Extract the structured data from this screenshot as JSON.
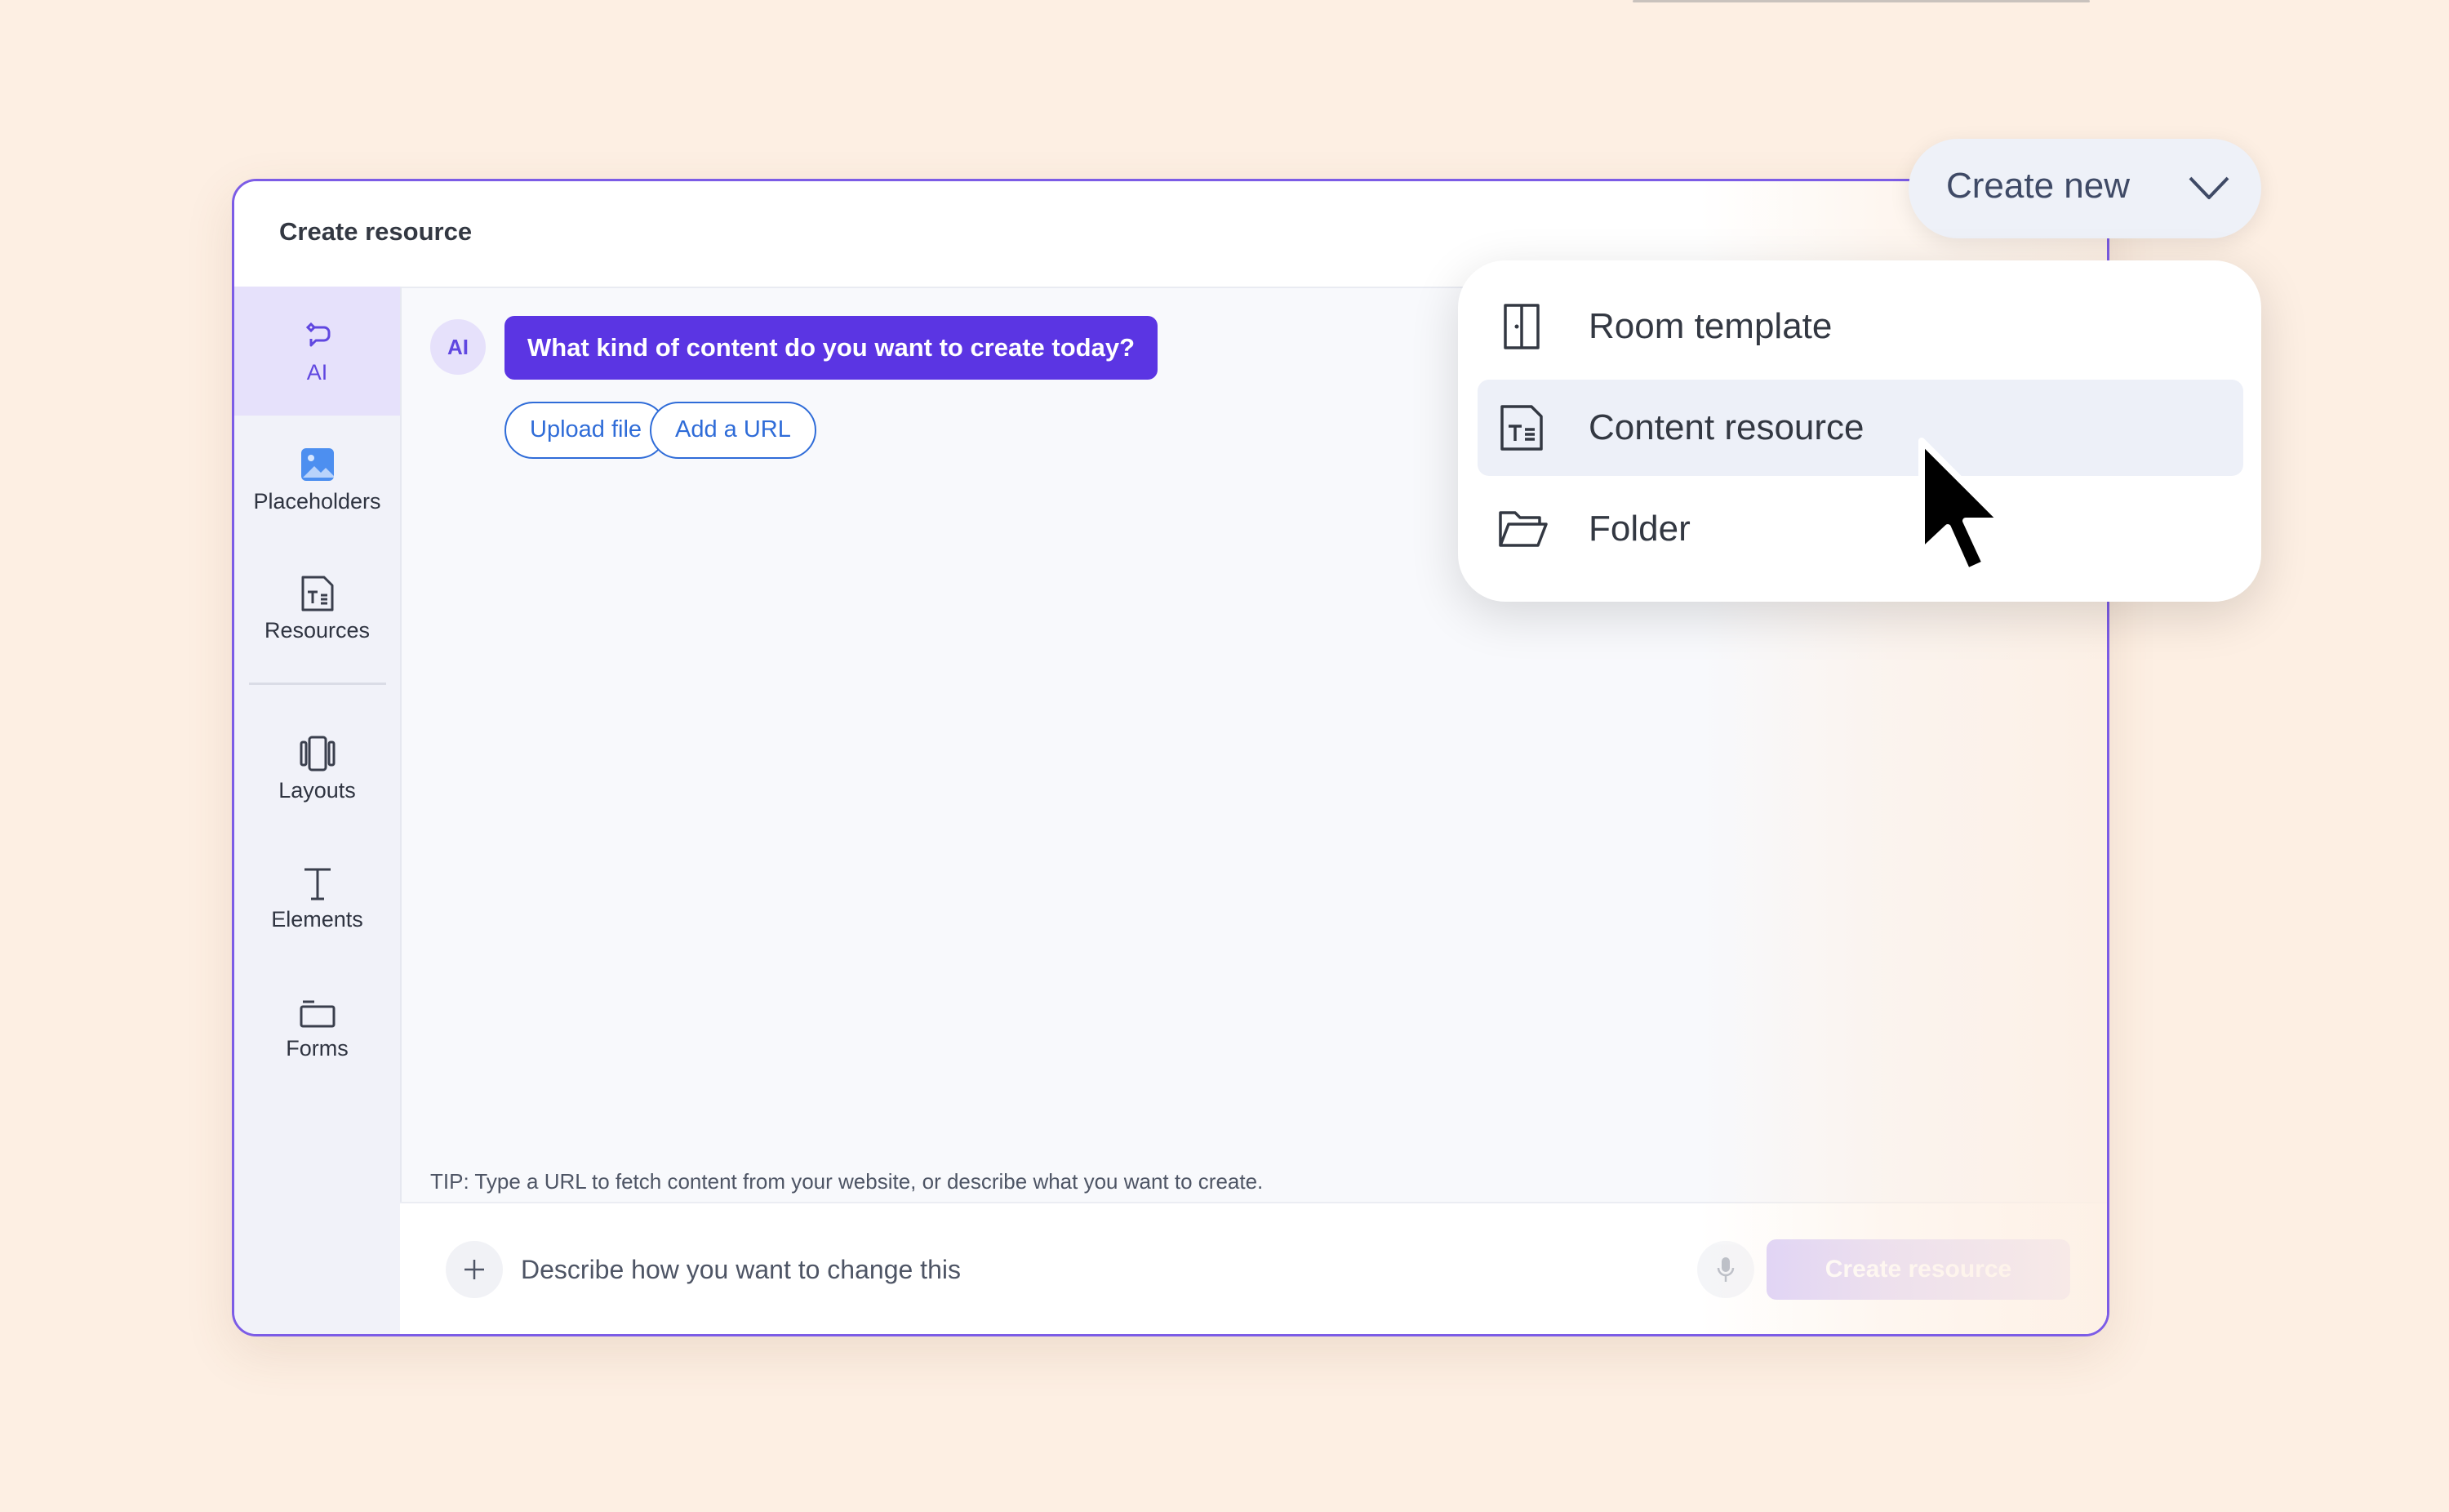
{
  "window": {
    "title": "Create resource"
  },
  "sidebar": {
    "items": [
      {
        "label": "AI",
        "icon": "ai-sparkle-icon",
        "active": true
      },
      {
        "label": "Placeholders",
        "icon": "image-icon"
      },
      {
        "label": "Resources",
        "icon": "document-text-icon"
      },
      {
        "label": "Layouts",
        "icon": "columns-icon"
      },
      {
        "label": "Elements",
        "icon": "text-t-icon"
      },
      {
        "label": "Forms",
        "icon": "form-folder-icon"
      }
    ]
  },
  "chat": {
    "avatar_label": "AI",
    "prompt": "What kind of content do you want to create today?",
    "actions": {
      "upload": "Upload file",
      "url": "Add a URL"
    },
    "tip": "TIP: Type a URL to fetch content from your website, or describe what you want to create."
  },
  "composer": {
    "placeholder": "Describe how you want to change this",
    "submit_label": "Create resource"
  },
  "create_new": {
    "label": "Create new",
    "menu": [
      {
        "label": "Room template",
        "icon": "door-icon"
      },
      {
        "label": "Content resource",
        "icon": "document-text-icon",
        "hovered": true
      },
      {
        "label": "Folder",
        "icon": "folder-open-icon"
      }
    ]
  },
  "colors": {
    "accent": "#5b35e3",
    "link": "#2f6cd8",
    "background": "#fdefe3"
  }
}
